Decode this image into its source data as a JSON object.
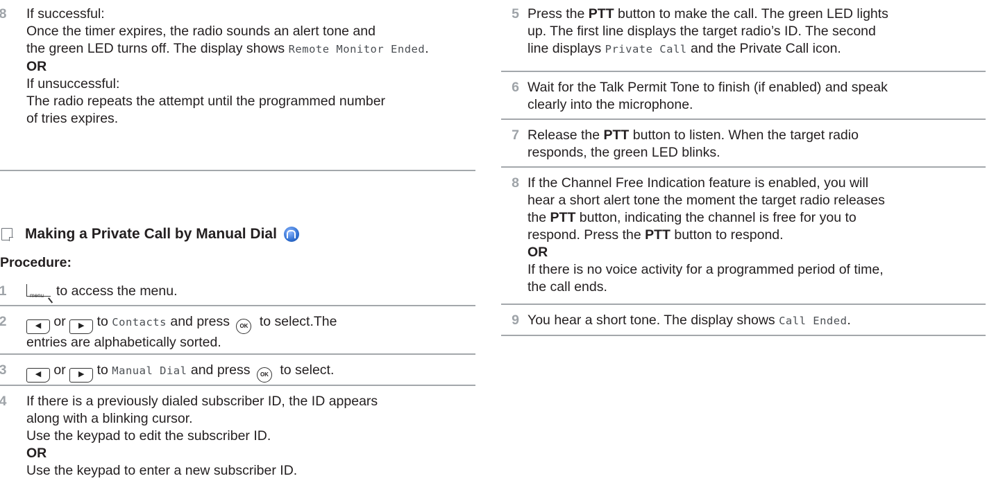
{
  "left": {
    "step8": {
      "num": "8",
      "lead": "If successful:",
      "line1": "Once the timer expires, the radio sounds an alert tone and",
      "line2": "the green LED turns off. The display shows ",
      "mono": "Remote Monitor Ended",
      "or": "OR",
      "lead2": "If unsuccessful:",
      "line3": "The radio repeats the attempt until the programmed number",
      "line4": "of tries expires."
    },
    "section_title": "Making a Private Call by Manual Dial",
    "procedure": "Procedure:",
    "step1": {
      "num": "1",
      "key": "menu",
      "text": "to access the menu."
    },
    "step2": {
      "num": "2",
      "or": "or",
      "to": "to ",
      "mono": "Contacts",
      "mid": " and press ",
      "ok": "OK",
      "end": " to select.The",
      "line2": "entries are alphabetically sorted."
    },
    "step3": {
      "num": "3",
      "or": "or",
      "to": "to ",
      "mono": "Manual Dial",
      "mid": " and press ",
      "ok": "OK",
      "end": " to select."
    },
    "step4": {
      "num": "4",
      "line1": "If there is a previously dialed subscriber ID, the ID appears",
      "line2": "along with a blinking cursor.",
      "line3": "Use the keypad to edit the subscriber ID.",
      "or": "OR",
      "line4": "Use the keypad to enter a new subscriber ID."
    }
  },
  "right": {
    "step5": {
      "num": "5",
      "a": "Press the ",
      "ptt": "PTT",
      "b": " button to make the call. The green LED lights",
      "line2": "up. The first line displays the target radio’s ID. The second",
      "c": "line displays ",
      "mono": "Private Call",
      "d": " and the Private Call icon."
    },
    "step6": {
      "num": "6",
      "line1": "Wait for the Talk Permit Tone to finish (if enabled) and speak",
      "line2": "clearly into the microphone."
    },
    "step7": {
      "num": "7",
      "a": "Release the ",
      "ptt": "PTT",
      "b": " button to listen. When the target radio",
      "line2": "responds, the green LED blinks."
    },
    "step8": {
      "num": "8",
      "line1": "If the Channel Free Indication feature is enabled, you will",
      "line2": "hear a short alert tone the moment the target radio releases",
      "a": "the ",
      "ptt": "PTT",
      "b": " button, indicating the channel is free for you to",
      "c": "respond. Press the ",
      "ptt2": "PTT",
      "d": " button to respond.",
      "or": "OR",
      "line5": "If there is no voice activity for a programmed period of time,",
      "line6": "the call ends."
    },
    "step9": {
      "num": "9",
      "a": "You hear a short tone. The display shows ",
      "mono": "Call Ended",
      "b": "."
    }
  }
}
